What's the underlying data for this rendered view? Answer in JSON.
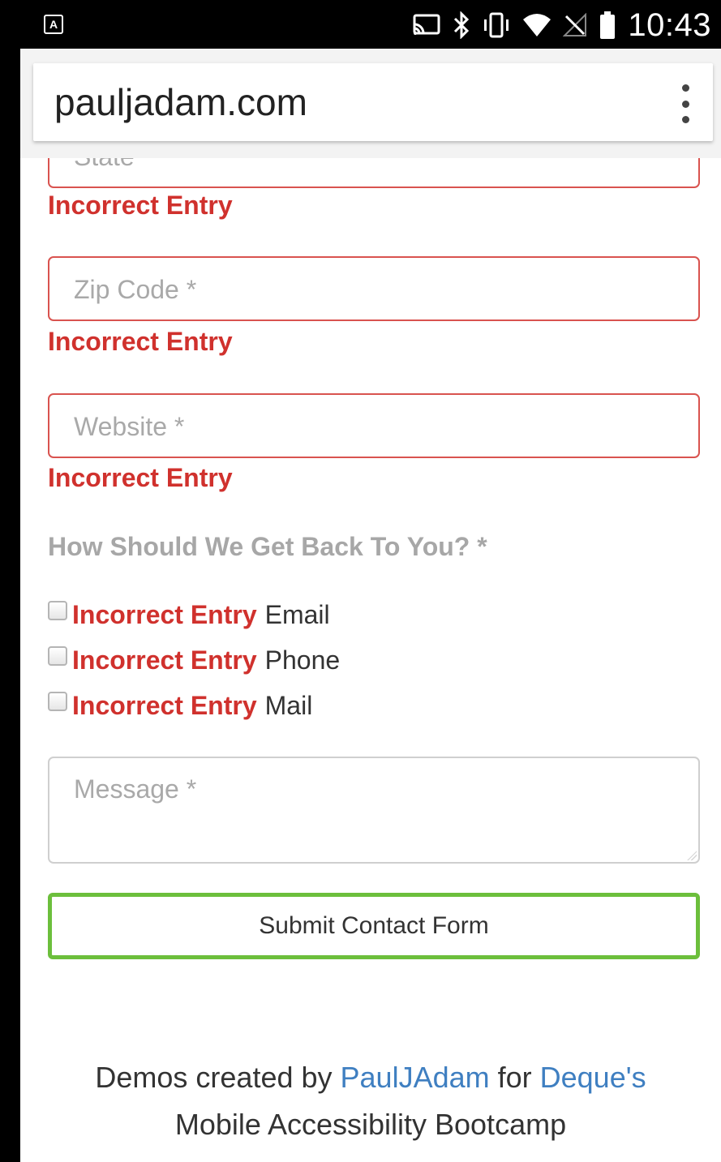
{
  "status_bar": {
    "notification_icon": "A",
    "icons": [
      "cast-icon",
      "bluetooth-icon",
      "vibrate-icon",
      "wifi-icon",
      "no-signal-icon",
      "battery-icon"
    ],
    "time": "10:43"
  },
  "browser": {
    "url": "pauljadam.com",
    "menu_icon": "overflow-menu-icon"
  },
  "form": {
    "state_placeholder": "State *",
    "state_error": "Incorrect Entry",
    "zip_placeholder": "Zip Code *",
    "zip_error": "Incorrect Entry",
    "website_placeholder": "Website *",
    "website_error": "Incorrect Entry",
    "contact_question": "How Should We Get Back To You? *",
    "contact_options": [
      {
        "error": "Incorrect Entry",
        "label": "Email"
      },
      {
        "error": "Incorrect Entry",
        "label": "Phone"
      },
      {
        "error": "Incorrect Entry",
        "label": "Mail"
      }
    ],
    "message_placeholder": "Message *",
    "submit_label": "Submit Contact Form"
  },
  "footer": {
    "prefix": "Demos created by ",
    "author_link": "PaulJAdam",
    "middle": " for ",
    "company_link": "Deque's",
    "line2": "Mobile Accessibility Bootcamp"
  },
  "colors": {
    "error": "#d0312d",
    "error_border": "#d9534f",
    "submit_border": "#6cbf3c",
    "link": "#3f7fc1"
  }
}
